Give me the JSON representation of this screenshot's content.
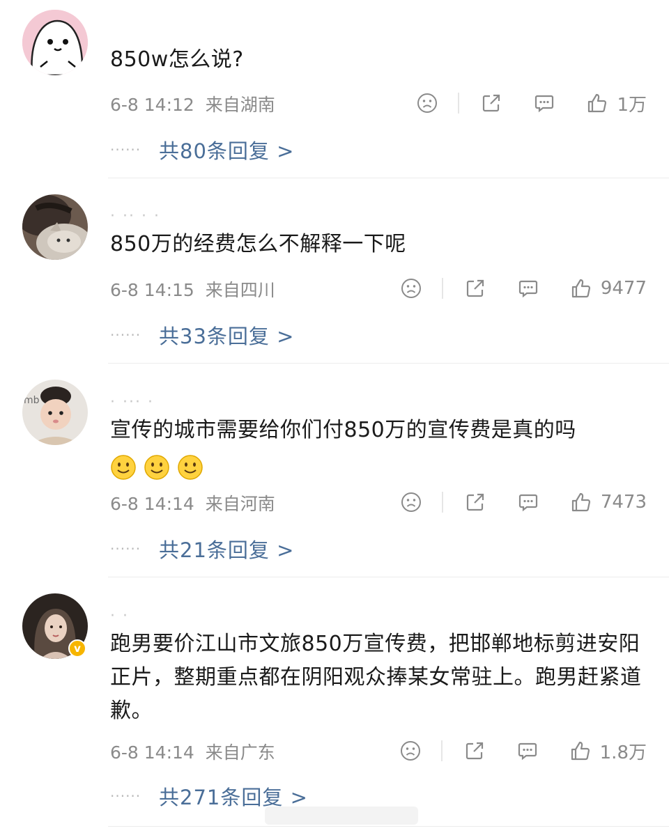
{
  "comments": [
    {
      "username": "",
      "text": "850w怎么说?",
      "emojis": [],
      "timestamp": "6-8 14:12",
      "location": "来自湖南",
      "likes": "1万",
      "replies": "共80条回复 >",
      "verified": false,
      "avatar_icon": "cute-blob-avatar"
    },
    {
      "username": "·  ·· · ·",
      "text": "850万的经费怎么不解释一下呢",
      "emojis": [],
      "timestamp": "6-8 14:15",
      "location": "来自四川",
      "likes": "9477",
      "replies": "共33条回复 >",
      "verified": false,
      "avatar_icon": "cat-photo-avatar"
    },
    {
      "username": "·  ···   ·",
      "text": "宣传的城市需要给你们付850万的宣传费是真的吗",
      "emojis": [
        "smile-emoji",
        "smile-emoji",
        "smile-emoji"
      ],
      "timestamp": "6-8 14:14",
      "location": "来自河南",
      "likes": "7473",
      "replies": "共21条回复 >",
      "verified": false,
      "avatar_icon": "child-photo-avatar"
    },
    {
      "username": "·  ·",
      "text": "跑男要价江山市文旅850万宣传费，把邯郸地标剪进安阳正片，整期重点都在阴阳观众捧某女常驻上。跑男赶紧道歉。",
      "emojis": [],
      "timestamp": "6-8 14:14",
      "location": "来自广东",
      "likes": "1.8万",
      "replies": "共271条回复 >",
      "verified": true,
      "avatar_icon": "woman-photo-avatar"
    }
  ],
  "dots": "······",
  "verified_badge": "v",
  "colors": {
    "text": "#1a1a1a",
    "meta": "#8a8a8a",
    "reply_link": "#4a6e98",
    "divider": "#ececec",
    "verified": "#f7b500"
  }
}
